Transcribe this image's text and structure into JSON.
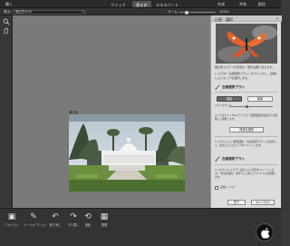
{
  "topbar": {
    "open": "開く",
    "tabs": [
      "クイック",
      "ガイド",
      "エキスパート"
    ],
    "active_tab": 1,
    "create": "作成",
    "share": "共有",
    "mode": "配信"
  },
  "viewbar": {
    "view_label": "表示:",
    "view_value": "補正前のみ",
    "zoom_label": "ズーム:",
    "zoom_value": "100%",
    "zoom_level": 0.2
  },
  "canvas": {
    "photo_label": "補正後"
  },
  "panel": {
    "title": "白黒 - 選択",
    "close": "×",
    "intro": "補正後 (カラー)の写真の一部を白黒に変えます。",
    "step1": "1. 以下の「白黒選択ブラシ」をクリックし、白黒にしたいエリアを選択します。",
    "brush1_label": "白黒選択ブラシ",
    "add_btn": "追加",
    "remove_btn": "削除",
    "brush_size_label": "ブラシのサイズ:",
    "brush_size_level": 0.4,
    "hint": "エリアをクリック&ドラッグして選択範囲を追加または削除して調整します。",
    "select_btn": "背景を選択",
    "step2": "2. (オプション) 選択範囲に「白黒選択ブラシ」を使用して、白黒にしたいエリアをペイントします。",
    "brush2_label": "白黒選択ブラシ",
    "step3": "3. (オプション) カラーの戻したい部分をペイントします。「背景を選択」を押下したあとブラシサイズを調整します。",
    "checkbox_label": "反転レイヤー",
    "done": "完了",
    "cancel": "キャンセル"
  },
  "bottombar": [
    {
      "icon": "photo-bin-icon",
      "label": "フォトビン"
    },
    {
      "icon": "tool-options-icon",
      "label": "ツールオプション"
    },
    {
      "icon": "undo-icon",
      "label": "取り消し"
    },
    {
      "icon": "redo-icon",
      "label": "やり直し"
    },
    {
      "icon": "rotate-icon",
      "label": "回転"
    },
    {
      "icon": "organizer-icon",
      "label": "整理"
    }
  ],
  "colors": {
    "active_tab": "#555555",
    "panel_bg": "#dcdcdc",
    "canvas_bg": "#7a7a7a",
    "accent": "#e8602c"
  }
}
